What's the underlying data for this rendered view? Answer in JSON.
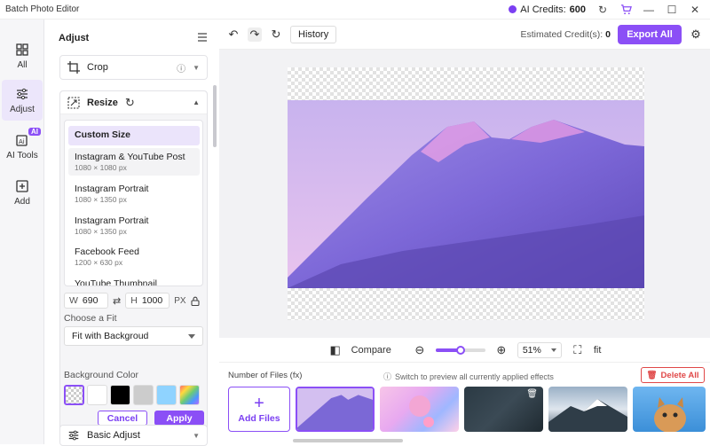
{
  "titlebar": {
    "app_title": "Batch Photo Editor",
    "credits_label": "AI Credits:",
    "credits_value": "600"
  },
  "rail": {
    "items": [
      {
        "label": "All",
        "icon": "grid-icon"
      },
      {
        "label": "Adjust",
        "icon": "sliders-icon"
      },
      {
        "label": "AI Tools",
        "icon": "ai-tools-icon",
        "badge": "AI"
      },
      {
        "label": "Add",
        "icon": "add-icon"
      }
    ],
    "active": "Adjust"
  },
  "panel": {
    "title": "Adjust",
    "crop_label": "Crop",
    "resize_label": "Resize",
    "presets": [
      {
        "name": "Custom Size",
        "dim": ""
      },
      {
        "name": "Instagram & YouTube Post",
        "dim": "1080 × 1080 px"
      },
      {
        "name": "Instagram Portrait",
        "dim": "1080 × 1350 px"
      },
      {
        "name": "Instagram Portrait",
        "dim": "1080 × 1350 px"
      },
      {
        "name": "Facebook Feed",
        "dim": "1200 × 630 px"
      },
      {
        "name": "YouTube Thumbnail",
        "dim": ""
      }
    ],
    "width_key": "W",
    "width_value": "690",
    "height_key": "H",
    "height_value": "1000",
    "unit": "PX",
    "fit_label": "Choose a Fit",
    "fit_value": "Fit with Backgroud",
    "bg_label": "Background Color",
    "swatch_colors": [
      "checker",
      "#ffffff",
      "#000000",
      "#cccccc",
      "#8fd3ff",
      "gradient"
    ],
    "cancel_label": "Cancel",
    "apply_label": "Apply",
    "basic_adjust_label": "Basic Adjust"
  },
  "toolbar": {
    "history_label": "History",
    "est_label": "Estimated Credit(s):",
    "est_value": "0",
    "export_label": "Export All"
  },
  "zoom": {
    "compare_label": "Compare",
    "zoom_value": "51%",
    "zoom_fraction": 0.51,
    "fit_label": "fit"
  },
  "files": {
    "label": "Number of Files (fx)",
    "hint": "Switch to preview all currently applied effects",
    "delete_label": "Delete All",
    "add_label": "Add Files"
  },
  "colors": {
    "accent": "#8b4ff6",
    "danger": "#e04848"
  }
}
